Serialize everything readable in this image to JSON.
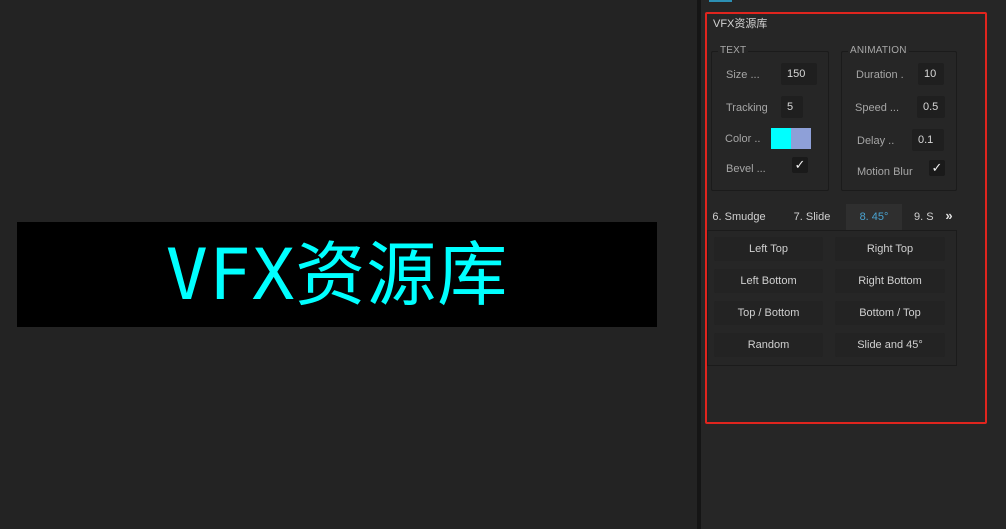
{
  "preview": {
    "text": "VFX资源库",
    "color": "#00ffff"
  },
  "panel": {
    "title": "VFX资源库",
    "highlight_color": "#e0251e",
    "text_group": {
      "title": "TEXT",
      "size_label": "Size ...",
      "size_value": "150",
      "tracking_label": "Tracking",
      "tracking_value": "5",
      "color_label": "Color ..",
      "color_swatches": [
        "#00ffff",
        "#8ea0d8"
      ],
      "bevel_label": "Bevel   ...",
      "bevel_checked": "✓"
    },
    "animation_group": {
      "title": "ANIMATION",
      "duration_label": "Duration .",
      "duration_value": "10",
      "speed_label": "Speed ...",
      "speed_value": "0.5",
      "delay_label": "Delay  ..",
      "delay_value": "0.1",
      "motion_blur_label": "Motion Blur",
      "motion_blur_checked": "✓"
    },
    "tabs": [
      {
        "label": "6. Smudge"
      },
      {
        "label": "7. Slide"
      },
      {
        "label": "8. 45°",
        "active": true
      },
      {
        "label": "9. S"
      }
    ],
    "tabs_more": "»",
    "buttons": [
      "Left Top",
      "Right Top",
      "Left Bottom",
      "Right Bottom",
      "Top / Bottom",
      "Bottom / Top",
      "Random",
      "Slide and 45°"
    ]
  }
}
